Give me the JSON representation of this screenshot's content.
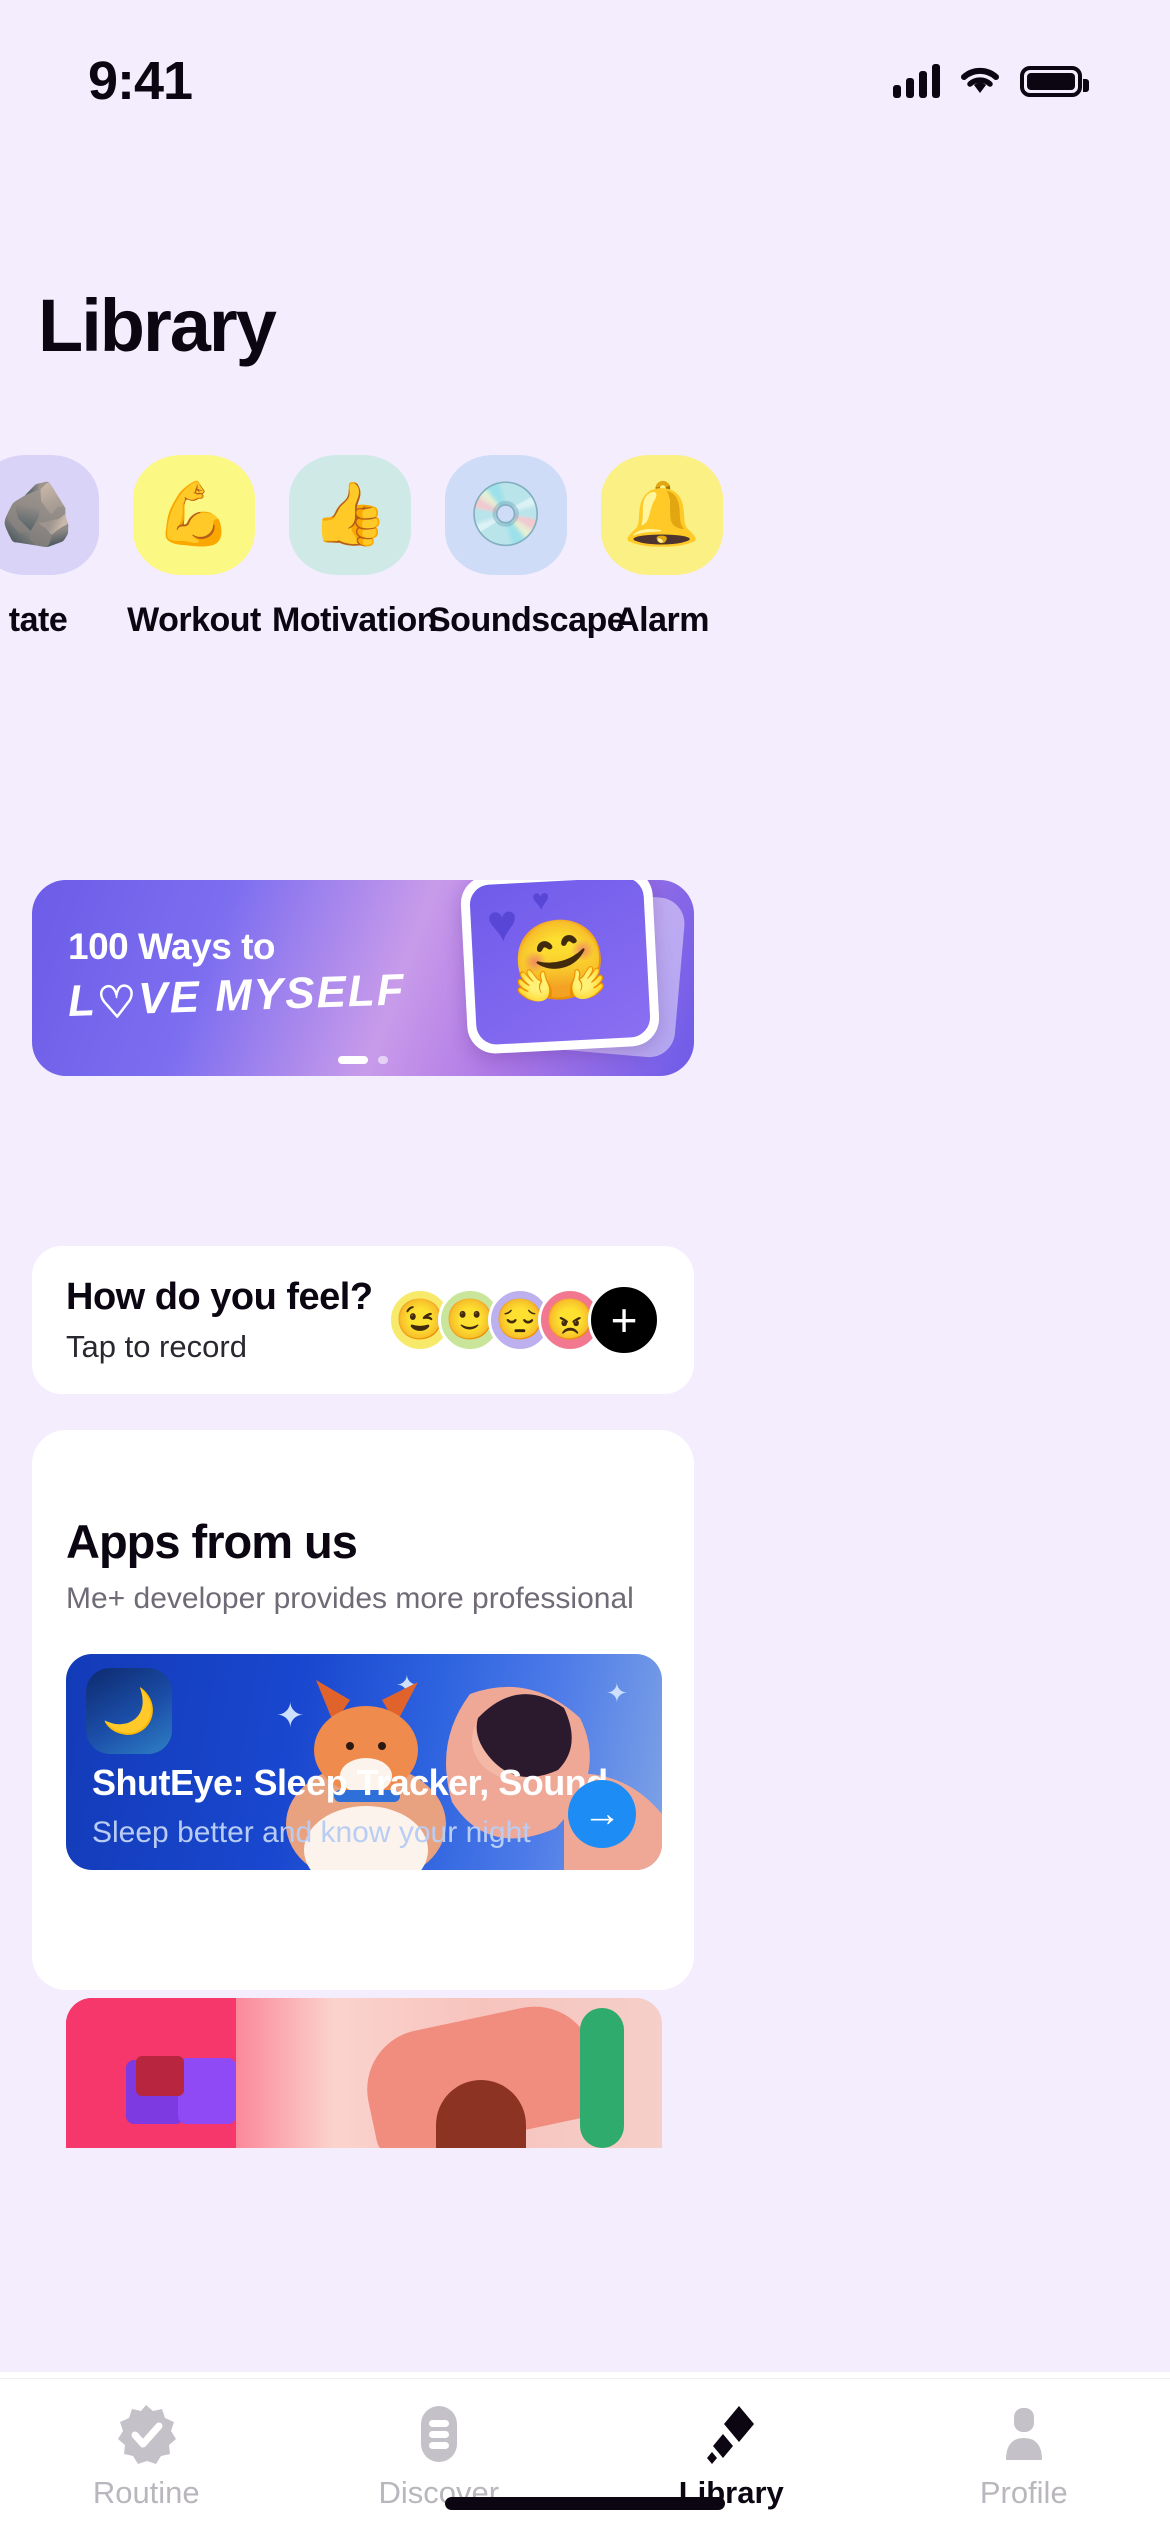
{
  "status_bar": {
    "time": "9:41",
    "signal_icon": "cellular-bars-icon",
    "wifi_icon": "wifi-icon",
    "battery_icon": "battery-full-icon"
  },
  "header": {
    "title": "Library"
  },
  "categories": [
    {
      "label": "tate",
      "full_label": "Meditate",
      "emoji": "🪨",
      "icon_name": "meditate-stones-icon",
      "bg": "#d9d4f7",
      "partial": true
    },
    {
      "label": "Workout",
      "full_label": "Workout",
      "emoji": "💪",
      "icon_name": "flexed-biceps-icon",
      "bg": "#fbf883",
      "partial": false
    },
    {
      "label": "Motivation",
      "full_label": "Motivation",
      "emoji": "👍",
      "icon_name": "thumbs-up-icon",
      "bg": "#cfe9e6",
      "partial": false
    },
    {
      "label": "Soundscape",
      "full_label": "Soundscape",
      "emoji": "💿",
      "icon_name": "vinyl-record-icon",
      "bg": "#cfdcf7",
      "partial": false
    },
    {
      "label": "Alarm",
      "full_label": "Alarm",
      "emoji": "🔔",
      "icon_name": "bell-icon",
      "bg": "#fbf083",
      "partial": false
    }
  ],
  "banner": {
    "line1": "100 Ways to",
    "line2_pre": "L",
    "line2_heart": "♡",
    "line2_post": "VE MYSELF",
    "heart_emoji": "🤗",
    "pagination": {
      "total": 2,
      "active_index": 0
    },
    "accent": "#6c5ce7"
  },
  "mood_card": {
    "title": "How do you feel?",
    "subtitle": "Tap to record",
    "faces": [
      {
        "name": "mood-happy-wink",
        "emoji": "😉",
        "bg": "#f7e96a"
      },
      {
        "name": "mood-content",
        "emoji": "🙂",
        "bg": "#c8e59a"
      },
      {
        "name": "mood-sad",
        "emoji": "😔",
        "bg": "#bcb0ef"
      },
      {
        "name": "mood-angry",
        "emoji": "😠",
        "bg": "#f2788f"
      }
    ],
    "add_label": "+"
  },
  "apps_section": {
    "title": "Apps from us",
    "subtitle": "Me+ developer provides more professional",
    "apps": [
      {
        "name": "ShutEye: Sleep Tracker, Sound",
        "description": "Sleep better and know your night",
        "icon_emoji": "🌙",
        "arrow": "→",
        "accent": "#1d8cf5"
      }
    ]
  },
  "tabbar": {
    "items": [
      {
        "label": "Routine",
        "icon_name": "badge-check-icon",
        "active": false
      },
      {
        "label": "Discover",
        "icon_name": "list-pill-icon",
        "active": false
      },
      {
        "label": "Library",
        "icon_name": "diamonds-icon",
        "active": true
      },
      {
        "label": "Profile",
        "icon_name": "person-icon",
        "active": false
      }
    ]
  }
}
